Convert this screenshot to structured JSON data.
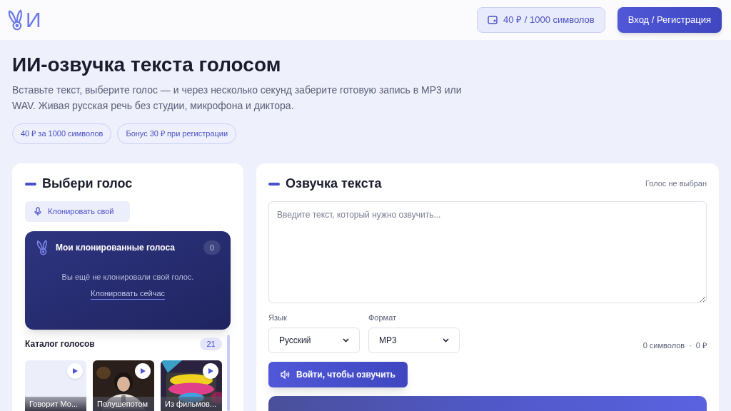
{
  "header": {
    "logo_text": "И",
    "price_chip": "40 ₽ / 1000 символов",
    "login_button": "Вход / Регистрация"
  },
  "hero": {
    "title": "ИИ-озвучка текста голосом",
    "description": "Вставьте текст, выберите голос — и через несколько секунд заберите готовую запись в MP3 или WAV. Живая русская речь без студии, микрофона и диктора.",
    "chips": [
      "40 ₽ за 1000 символов",
      "Бонус 30 ₽ при регистрации"
    ]
  },
  "voices_panel": {
    "title": "Выбери голос",
    "clone_button": "Клонировать свой",
    "cloned": {
      "title": "Мои клонированные голоса",
      "count": "0",
      "empty_text": "Вы ещё не клонировали свой голос.",
      "clone_link": "Клонировать сейчас"
    },
    "catalog": {
      "title": "Каталог голосов",
      "count": "21",
      "voices": [
        {
          "name": "Говорит Мо...",
          "kind": "blank"
        },
        {
          "name": "Полушепотом",
          "kind": "picture"
        },
        {
          "name": "Из фильмов...",
          "kind": "picture"
        }
      ]
    }
  },
  "tts_panel": {
    "title": "Озвучка текста",
    "voice_status": "Голос не выбран",
    "text_placeholder": "Введите текст, который нужно озвучить...",
    "language": {
      "label": "Язык",
      "value": "Русский"
    },
    "format": {
      "label": "Формат",
      "value": "MP3"
    },
    "chars": "0 символов",
    "separator": "·",
    "cost": "0 ₽",
    "submit_button": "Войти, чтобы озвучить"
  }
}
